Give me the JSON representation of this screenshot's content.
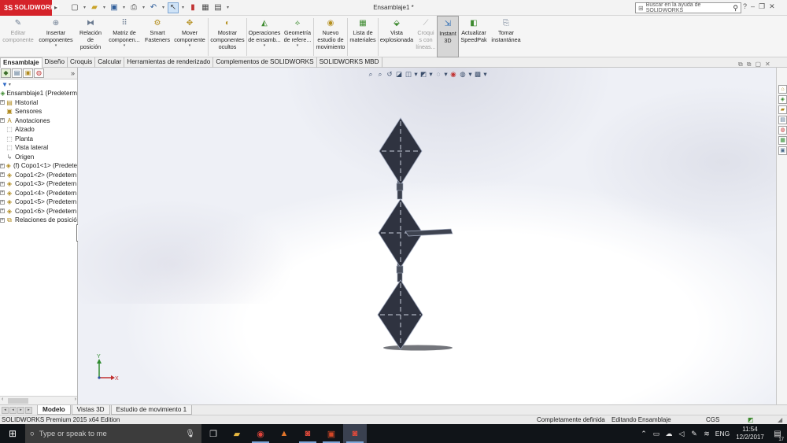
{
  "app": {
    "logo_text": "SOLIDWORKS",
    "logo_mark": "3S",
    "document_title": "Ensamblaje1 *",
    "help_search_placeholder": "Buscar en la ayuda de SOLIDWORKS"
  },
  "ribbon": {
    "buttons": [
      {
        "id": "editar",
        "label1": "Editar",
        "label2": "componente",
        "disabled": true
      },
      {
        "id": "insertar",
        "label1": "Insertar",
        "label2": "componentes",
        "caret": true
      },
      {
        "id": "relacion",
        "label1": "Relación",
        "label2": "de",
        "label3": "posición"
      },
      {
        "id": "matriz",
        "label1": "Matriz de",
        "label2": "componen...",
        "caret": true
      },
      {
        "id": "smart",
        "label1": "Smart",
        "label2": "Fasteners"
      },
      {
        "id": "mover",
        "label1": "Mover",
        "label2": "componente",
        "caret": true
      },
      {
        "id": "mostrar",
        "label1": "Mostrar",
        "label2": "componentes",
        "label3": "ocultos"
      },
      {
        "id": "operaciones",
        "label1": "Operaciones",
        "label2": "de ensamb...",
        "caret": true
      },
      {
        "id": "geometria",
        "label1": "Geometría",
        "label2": "de refere...",
        "caret": true
      },
      {
        "id": "nuevo",
        "label1": "Nuevo",
        "label2": "estudio de",
        "label3": "movimiento"
      },
      {
        "id": "lista",
        "label1": "Lista de",
        "label2": "materiales"
      },
      {
        "id": "vista",
        "label1": "Vista",
        "label2": "explosionada"
      },
      {
        "id": "croquis",
        "label1": "Croqui",
        "label2": "s con",
        "label3": "líneas...",
        "disabled": true
      },
      {
        "id": "instant3d",
        "label1": "Instant",
        "label2": "3D",
        "active": true
      },
      {
        "id": "speedpak",
        "label1": "Actualizar",
        "label2": "SpeedPak"
      },
      {
        "id": "tomar",
        "label1": "Tomar",
        "label2": "instantánea"
      }
    ]
  },
  "cm_tabs": [
    "Ensamblaje",
    "Diseño",
    "Croquis",
    "Calcular",
    "Herramientas de renderizado",
    "Complementos de SOLIDWORKS",
    "SOLIDWORKS MBD"
  ],
  "tree": {
    "root": "Ensamblaje1  (Predeterm",
    "items": [
      {
        "label": "Historial",
        "exp": true,
        "icon": "▤"
      },
      {
        "label": "Sensores",
        "exp": false,
        "icon": "▣"
      },
      {
        "label": "Anotaciones",
        "exp": true,
        "icon": "A"
      },
      {
        "label": "Alzado",
        "exp": false,
        "icon": "⬚"
      },
      {
        "label": "Planta",
        "exp": false,
        "icon": "⬚"
      },
      {
        "label": "Vista lateral",
        "exp": false,
        "icon": "⬚"
      },
      {
        "label": "Origen",
        "exp": false,
        "icon": "↳"
      },
      {
        "label": "(f) Copo1<1> (Predete",
        "exp": true,
        "icon": "◈"
      },
      {
        "label": "Copo1<2> (Predetern",
        "exp": true,
        "icon": "◈"
      },
      {
        "label": "Copo1<3> (Predetern",
        "exp": true,
        "icon": "◈"
      },
      {
        "label": "Copo1<4> (Predetern",
        "exp": true,
        "icon": "◈"
      },
      {
        "label": "Copo1<5> (Predetern",
        "exp": true,
        "icon": "◈"
      },
      {
        "label": "Copo1<6> (Predetern",
        "exp": true,
        "icon": "◈"
      },
      {
        "label": "Relaciones de posició",
        "exp": true,
        "icon": "⧉"
      }
    ]
  },
  "bottom_tabs": [
    "Modelo",
    "Vistas 3D",
    "Estudio de movimiento 1"
  ],
  "status": {
    "edition": "SOLIDWORKS Premium 2015 x64 Edition",
    "definition": "Completamente definida",
    "mode": "Editando Ensamblaje",
    "units": "CGS"
  },
  "triad": {
    "y": "Y",
    "x": "X"
  },
  "taskbar": {
    "search_placeholder": "Type or speak to me",
    "lang": "ENG",
    "time": "11:54",
    "date": "12/2/2017",
    "notifications": "17"
  },
  "colors": {
    "brand_red": "#d5232a",
    "model_fill": "#2f3340",
    "model_edge": "#9aa3b8"
  }
}
